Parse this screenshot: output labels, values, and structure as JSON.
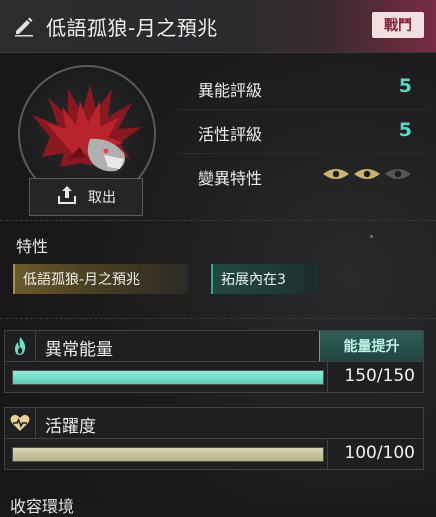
{
  "header": {
    "title": "低語孤狼-月之預兆",
    "badge": "戰鬥",
    "edit_icon": "pencil-icon"
  },
  "avatar": {
    "take_out_label": "取出",
    "take_out_icon": "upload-icon"
  },
  "ratings": [
    {
      "label": "異能評級",
      "value": "5"
    },
    {
      "label": "活性評級",
      "value": "5"
    },
    {
      "label": "變異特性",
      "eyes_active": 2,
      "eyes_total": 3
    }
  ],
  "traits": {
    "title": "特性",
    "items": [
      "低語孤狼-月之預兆",
      "拓展內在3"
    ]
  },
  "energy": {
    "name": "異常能量",
    "icon": "flame-icon",
    "boost_label": "能量提升",
    "current": 150,
    "max": 150,
    "display": "150/150"
  },
  "vitality": {
    "name": "活躍度",
    "icon": "heart-pulse-icon",
    "current": 100,
    "max": 100,
    "display": "100/100"
  },
  "footer_partial": "收容環境",
  "colors": {
    "accent_teal": "#54d9c5",
    "badge_red": "#8a1f35",
    "gold": "#a88e48"
  }
}
